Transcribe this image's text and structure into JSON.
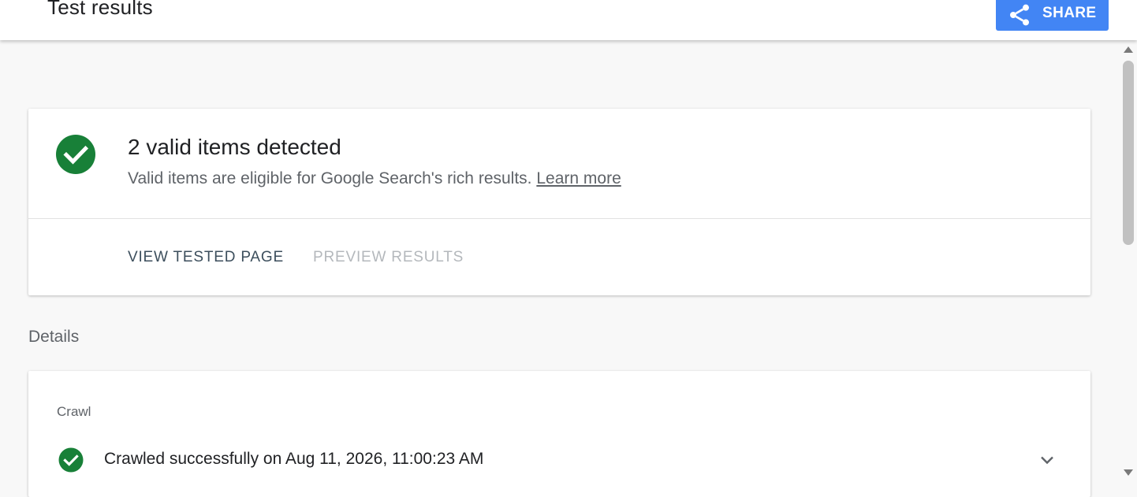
{
  "header": {
    "title": "Test results",
    "share_label": "SHARE",
    "share_icon": "share-icon",
    "accent_color": "#4285f4"
  },
  "summary": {
    "status_icon": "check-circle-icon",
    "status_color": "#188038",
    "title": "2 valid items detected",
    "description": "Valid items are eligible for Google Search's rich results.",
    "learn_more": "Learn more",
    "tabs": [
      {
        "label": "VIEW TESTED PAGE",
        "enabled": true
      },
      {
        "label": "PREVIEW RESULTS",
        "enabled": false
      }
    ]
  },
  "details": {
    "label": "Details",
    "crawl": {
      "section_label": "Crawl",
      "status_icon": "check-circle-icon",
      "status_text": "Crawled successfully on Aug 11, 2026, 11:00:23 AM",
      "expand_icon": "chevron-down-icon"
    }
  }
}
